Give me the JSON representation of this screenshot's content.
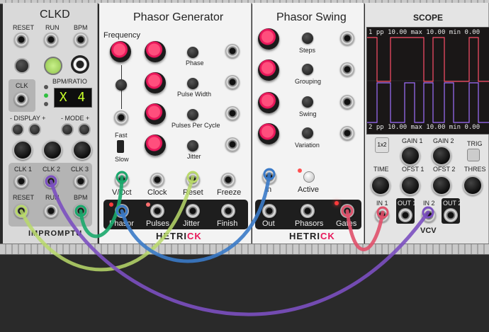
{
  "clkd": {
    "title": "CLKD",
    "reset_label": "RESET",
    "run_label": "RUN",
    "bpm_label": "BPM",
    "clk_label": "CLK",
    "bpm_ratio_label": "BPM/RATIO",
    "display_value": "X 4",
    "display_label": "- DISPLAY +",
    "mode_label": "- MODE +",
    "clk1_label": "CLK 1",
    "clk2_label": "CLK 2",
    "clk3_label": "CLK 3",
    "reset_jack_label": "RESET",
    "run_jack_label": "RUN",
    "bpm_jack_label": "BPM",
    "brand": "IMPROMPTU"
  },
  "phasor_generator": {
    "title": "Phasor Generator",
    "frequency_label": "Frequency",
    "phase_label": "Phase",
    "pulse_width_label": "Pulse Width",
    "pulses_per_cycle_label": "Pulses Per Cycle",
    "jitter_label": "Jitter",
    "fast_label": "Fast",
    "slow_label": "Slow",
    "voct_label": "V/Oct",
    "clock_label": "Clock",
    "reset_label": "Reset",
    "freeze_label": "Freeze",
    "out_phasor_label": "Phasor",
    "out_pulses_label": "Pulses",
    "out_jitter_label": "Jitter",
    "out_finish_label": "Finish",
    "brand_prefix": "HETRI",
    "brand_suffix": "CK"
  },
  "phasor_swing": {
    "title": "Phasor Swing",
    "steps_label": "Steps",
    "grouping_label": "Grouping",
    "swing_label": "Swing",
    "variation_label": "Variation",
    "in_label": "In",
    "active_label": "Active",
    "out_label": "Out",
    "phasors_label": "Phasors",
    "gates_label": "Gates",
    "brand_prefix": "HETRI",
    "brand_suffix": "CK"
  },
  "scope": {
    "title": "SCOPE",
    "readout_1": "1  pp  10.00  max 10.00  min  0.00",
    "readout_2": "2  pp  10.00  max 10.00  min  0.00",
    "x12_label": "1x2",
    "gain1_label": "GAIN 1",
    "gain2_label": "GAIN 2",
    "trig_label": "TRIG",
    "time_label": "TIME",
    "ofst1_label": "OFST 1",
    "ofst2_label": "OFST 2",
    "thres_label": "THRES",
    "in1_label": "IN 1",
    "out1_label": "OUT 1",
    "in2_label": "IN 2",
    "out2_label": "OUT 2",
    "brand": "VCV",
    "trace1_color": "#ff4f6a",
    "trace2_color": "#a070ff"
  },
  "cable_colors": {
    "green": "#1aa86c",
    "lime": "#b9d96a",
    "purple": "#7b4fc0",
    "blue": "#3a7ac8",
    "red": "#e0506a"
  }
}
